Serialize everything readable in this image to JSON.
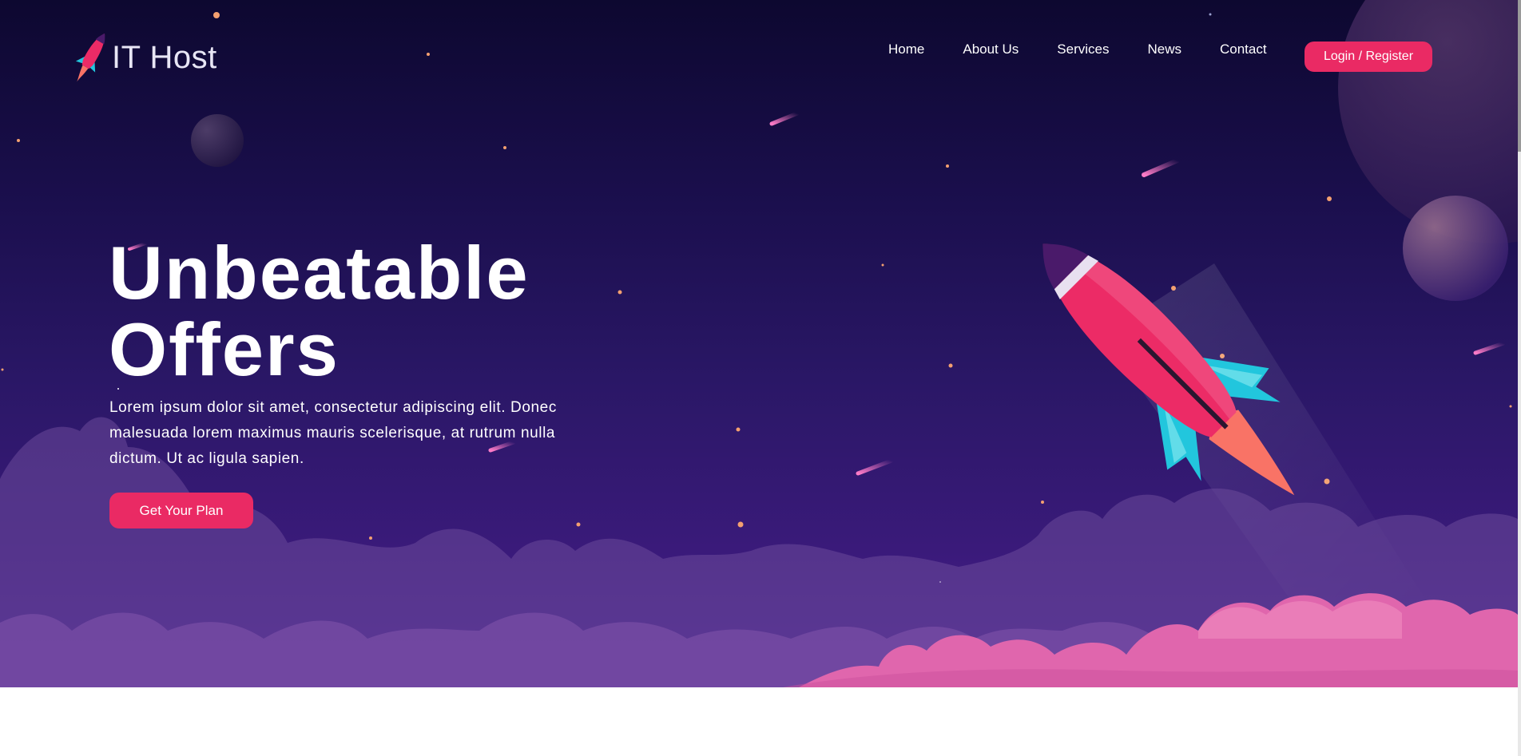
{
  "brand": {
    "name": "IT Host",
    "logo_icon": "rocket-icon"
  },
  "nav": {
    "items": [
      {
        "label": "Home"
      },
      {
        "label": "About Us"
      },
      {
        "label": "Services"
      },
      {
        "label": "News"
      },
      {
        "label": "Contact"
      }
    ],
    "login_label": "Login / Register"
  },
  "hero": {
    "headline_line1": "Unbeatable",
    "headline_line2": "Offers",
    "description": "Lorem ipsum dolor sit amet, consectetur adipiscing elit. Donec malesuada lorem maximus mauris scelerisque, at rutrum nulla dictum. Ut ac ligula sapien.",
    "cta_label": "Get Your Plan",
    "illustration_icon": "rocket-illustration-icon"
  },
  "colors": {
    "accent": "#ea2a64",
    "background_top": "#0d0830",
    "background_bottom": "#4a2190",
    "cloud_pink": "#e66aac",
    "rocket_body": "#ec2b66",
    "rocket_fins": "#22c6dd",
    "flame": "#f97366"
  }
}
